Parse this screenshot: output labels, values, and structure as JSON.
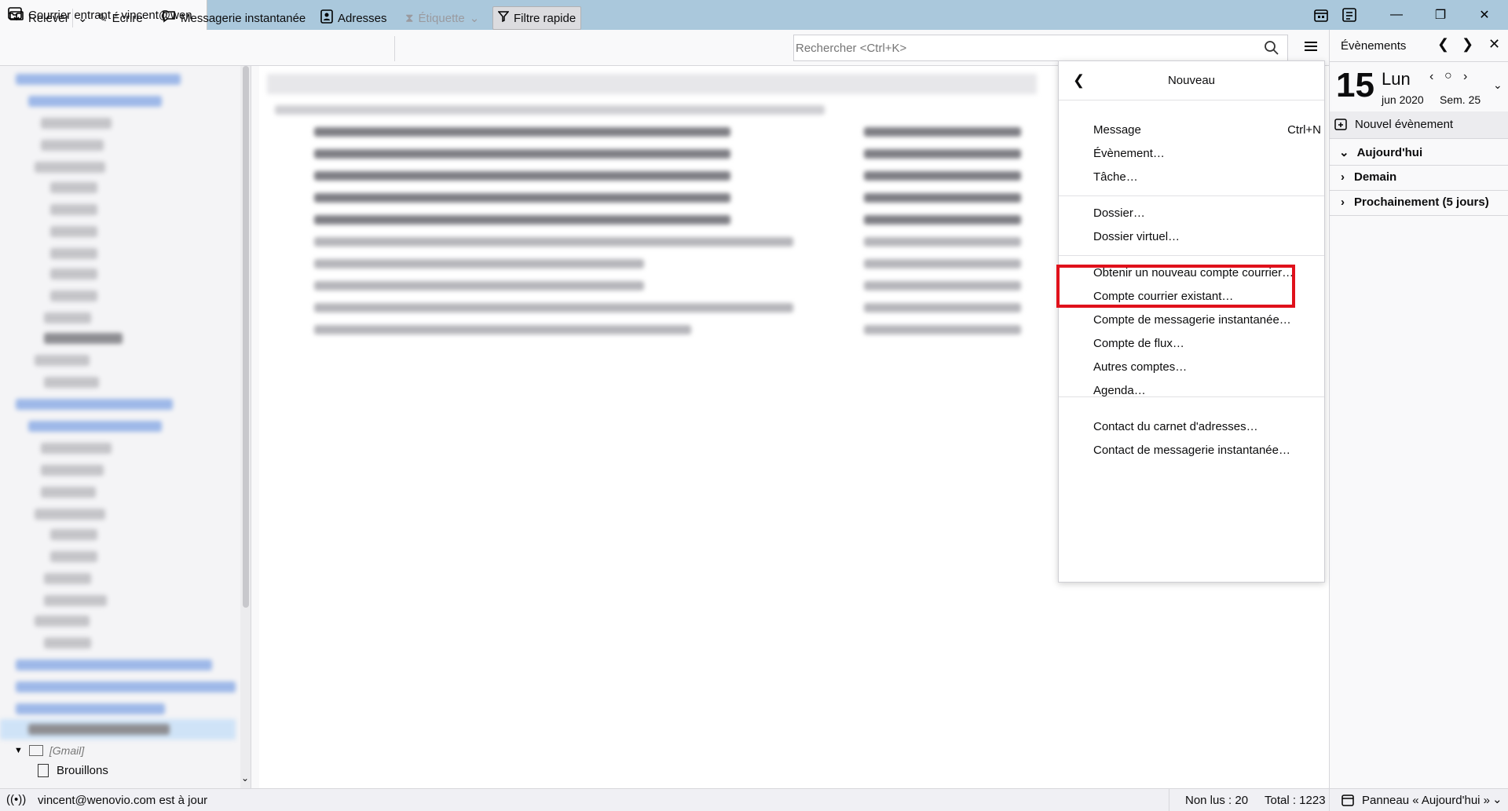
{
  "window": {
    "tab_title": "Courrier entrant - vincent@wen",
    "calendar_icon": "calendar-icon",
    "tasks_icon": "tasks-icon"
  },
  "toolbar": {
    "get_mail": "Relever",
    "write": "Écrire",
    "chat": "Messagerie instantanée",
    "address_book": "Adresses",
    "tag": "Étiquette",
    "quick_filter": "Filtre rapide",
    "search_placeholder": "Rechercher <Ctrl+K>"
  },
  "folder_pane": {
    "visible_folders": [
      "[Gmail]",
      "Brouillons"
    ]
  },
  "today_pane": {
    "title": "Évènements",
    "day_number": "15",
    "weekday": "Lun",
    "month_year": "jun 2020",
    "week": "Sem. 25",
    "new_event": "Nouvel évènement",
    "sections": [
      "Aujourd'hui",
      "Demain",
      "Prochainement (5 jours)"
    ]
  },
  "menu": {
    "title": "Nouveau",
    "group1": [
      {
        "label": "Message",
        "shortcut": "Ctrl+N"
      },
      {
        "label": "Évènement…",
        "shortcut": ""
      },
      {
        "label": "Tâche…",
        "shortcut": ""
      }
    ],
    "group2": [
      "Dossier…",
      "Dossier virtuel…"
    ],
    "group3": [
      "Obtenir un nouveau compte courrier…",
      "Compte courrier existant…",
      "Compte de messagerie instantanée…",
      "Compte de flux…",
      "Autres comptes…",
      "Agenda…"
    ],
    "group4": [
      "Contact du carnet d'adresses…",
      "Contact de messagerie instantanée…"
    ]
  },
  "status": {
    "account_status": "vincent@wenovio.com est à jour",
    "unread": "Non lus : 20",
    "total": "Total : 1223",
    "today_pane_toggle": "Panneau « Aujourd'hui »"
  },
  "colors": {
    "titlebar": "#aac8dc",
    "highlight_box": "#e0111b"
  }
}
